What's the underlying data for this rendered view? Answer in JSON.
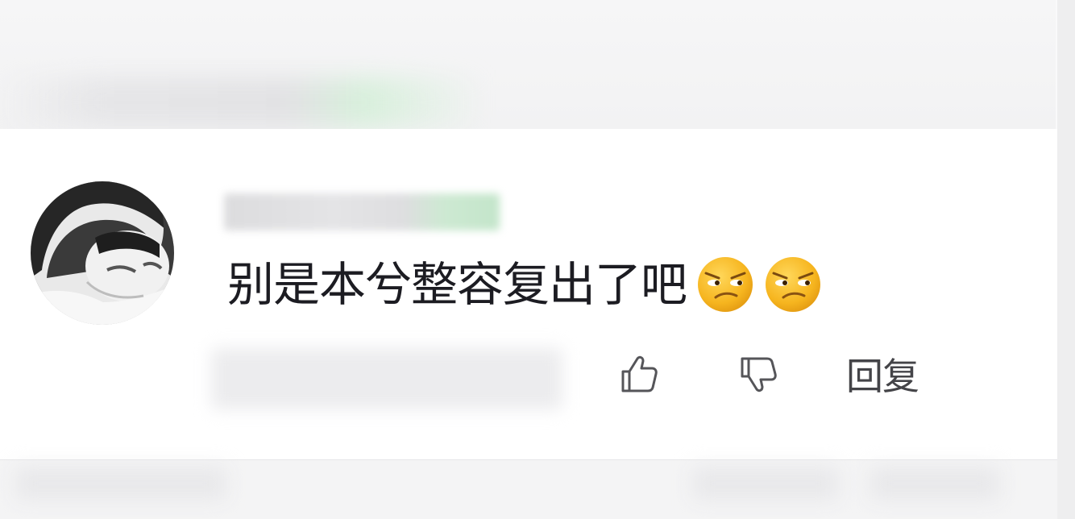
{
  "comment": {
    "text": "别是本兮整容复出了吧",
    "emoji_icons": [
      "smirk-emoji",
      "smirk-emoji"
    ]
  },
  "actions": {
    "like_icon": "thumbs-up-icon",
    "dislike_icon": "thumbs-down-icon",
    "reply_label": "回复"
  },
  "colors": {
    "text": "#1c1c22",
    "icon": "#555559",
    "emoji_fill": "#f6b51f",
    "blur_green": "#c3e5ca"
  }
}
